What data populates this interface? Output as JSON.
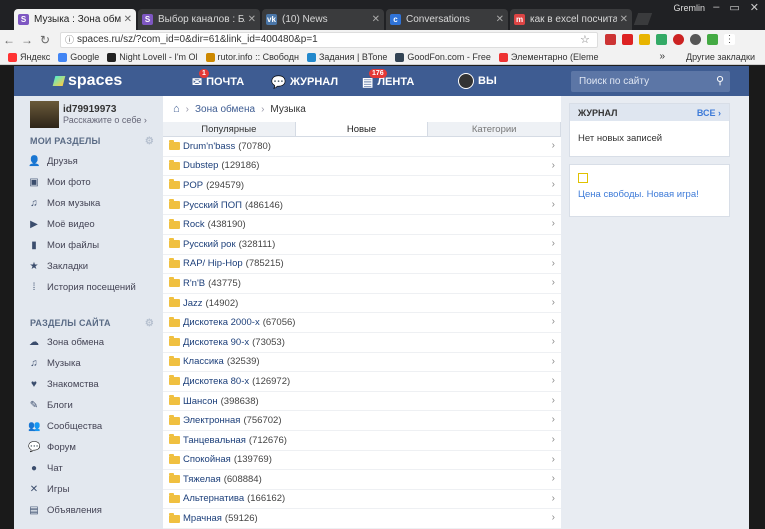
{
  "browser": {
    "tabs": [
      {
        "title": "Музыка : Зона обмена",
        "favicon": "S",
        "color": "#7e57c2",
        "active": true
      },
      {
        "title": "Выбор каналов : Блоги",
        "favicon": "S",
        "color": "#7e57c2",
        "active": false
      },
      {
        "title": "(10) News",
        "favicon": "vk",
        "color": "#4a76a8",
        "active": false
      },
      {
        "title": "Conversations",
        "favicon": "c",
        "color": "#2f73d8",
        "active": false
      },
      {
        "title": "как в excel посчитать пр",
        "favicon": "m",
        "color": "#d44",
        "active": false
      }
    ],
    "user": "Gremlin",
    "url": "spaces.ru/sz/?com_id=0&dir=61&link_id=400480&p=1",
    "bookmarks": [
      {
        "label": "Яндекс",
        "color": "#f33"
      },
      {
        "label": "Google",
        "color": "#4285f4"
      },
      {
        "label": "Night Lovell - I'm Ol",
        "color": "#222"
      },
      {
        "label": "rutor.info :: Свободн",
        "color": "#c80"
      },
      {
        "label": "Задания | BTone",
        "color": "#28c"
      },
      {
        "label": "GoodFon.com - Free",
        "color": "#345"
      },
      {
        "label": "Элементарно (Eleme",
        "color": "#e33"
      }
    ],
    "bookmarks_more": "»",
    "other_bookmarks": "Другие закладки"
  },
  "site": {
    "logo": "spaces",
    "nav": {
      "mail": "ПОЧТА",
      "mail_badge": "1",
      "journal": "ЖУРНАЛ",
      "feed": "ЛЕНТА",
      "feed_badge": "176",
      "you": "ВЫ"
    },
    "search_placeholder": "Поиск по сайту"
  },
  "sidebar": {
    "username": "id79919973",
    "about": "Расскажите о себе ›",
    "my_sections_title": "МОИ РАЗДЕЛЫ",
    "my_sections": [
      {
        "label": "Друзья",
        "icon": "👤"
      },
      {
        "label": "Мои фото",
        "icon": "▣"
      },
      {
        "label": "Моя музыка",
        "icon": "♫"
      },
      {
        "label": "Моё видео",
        "icon": "▶"
      },
      {
        "label": "Мои файлы",
        "icon": "▮"
      },
      {
        "label": "Закладки",
        "icon": "★"
      },
      {
        "label": "История посещений",
        "icon": "⁞"
      }
    ],
    "site_sections_title": "РАЗДЕЛЫ САЙТА",
    "site_sections": [
      {
        "label": "Зона обмена",
        "icon": "☁"
      },
      {
        "label": "Музыка",
        "icon": "♫"
      },
      {
        "label": "Знакомства",
        "icon": "♥"
      },
      {
        "label": "Блоги",
        "icon": "✎"
      },
      {
        "label": "Сообщества",
        "icon": "👥"
      },
      {
        "label": "Форум",
        "icon": "💬"
      },
      {
        "label": "Чат",
        "icon": "●"
      },
      {
        "label": "Игры",
        "icon": "✕"
      },
      {
        "label": "Объявления",
        "icon": "▤"
      }
    ]
  },
  "content": {
    "breadcrumb_link": "Зона обмена",
    "breadcrumb_current": "Музыка",
    "tabs": [
      "Популярные",
      "Новые",
      "Категории"
    ],
    "folders": [
      {
        "name": "Drum'n'bass",
        "count": "(70780)"
      },
      {
        "name": "Dubstep",
        "count": "(129186)"
      },
      {
        "name": "POP",
        "count": "(294579)"
      },
      {
        "name": "Русский ПОП",
        "count": "(486146)"
      },
      {
        "name": "Rock",
        "count": "(438190)"
      },
      {
        "name": "Русский рок",
        "count": "(328111)"
      },
      {
        "name": "RAP/ Hip-Hop",
        "count": "(785215)"
      },
      {
        "name": "R'n'B",
        "count": "(43775)"
      },
      {
        "name": "Jazz",
        "count": "(14902)"
      },
      {
        "name": "Дискотека 2000-х",
        "count": "(67056)"
      },
      {
        "name": "Дискотека 90-х",
        "count": "(73053)"
      },
      {
        "name": "Классика",
        "count": "(32539)"
      },
      {
        "name": "Дискотека 80-х",
        "count": "(126972)"
      },
      {
        "name": "Шансон",
        "count": "(398638)"
      },
      {
        "name": "Электронная",
        "count": "(756702)"
      },
      {
        "name": "Танцевальная",
        "count": "(712676)"
      },
      {
        "name": "Спокойная",
        "count": "(139769)"
      },
      {
        "name": "Тяжелая",
        "count": "(608884)"
      },
      {
        "name": "Альтернатива",
        "count": "(166162)"
      },
      {
        "name": "Мрачная",
        "count": "(59126)"
      }
    ]
  },
  "right": {
    "journal_title": "ЖУРНАЛ",
    "journal_all": "ВСЕ ›",
    "journal_empty": "Нет новых записей",
    "ad_link": "Цена свободы. Новая игра!"
  }
}
